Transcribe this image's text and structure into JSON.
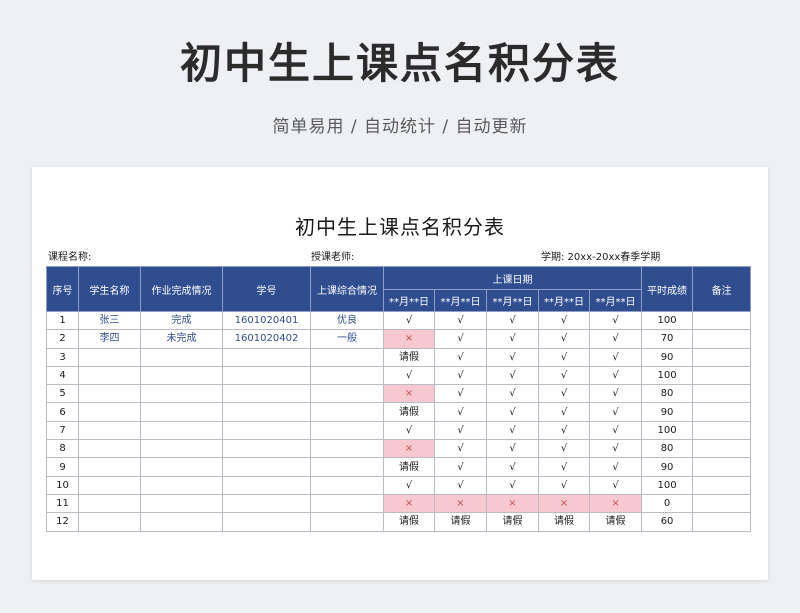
{
  "banner": {
    "title": "初中生上课点名积分表",
    "subtitle": "简单易用 / 自动统计 / 自动更新"
  },
  "sheet": {
    "title": "初中生上课点名积分表",
    "course_label": "课程名称:",
    "teacher_label": "授课老师:",
    "term_label": "学期:  20xx-20xx春季学期"
  },
  "table": {
    "headers": {
      "index": "序号",
      "name": "学生名称",
      "homework": "作业完成情况",
      "student_id": "学号",
      "overall": "上课综合情况",
      "dates_group": "上课日期",
      "dates": [
        "**月**日",
        "**月**日",
        "**月**日",
        "**月**日",
        "**月**日"
      ],
      "score": "平时成绩",
      "remark": "备注"
    },
    "rows": [
      {
        "index": "1",
        "name": "张三",
        "homework": "完成",
        "student_id": "1601020401",
        "overall": "优良",
        "d": [
          "√",
          "√",
          "√",
          "√",
          "√"
        ],
        "score": "100",
        "remark": ""
      },
      {
        "index": "2",
        "name": "李四",
        "homework": "未完成",
        "student_id": "1601020402",
        "overall": "一般",
        "d": [
          "×",
          "√",
          "√",
          "√",
          "√"
        ],
        "score": "70",
        "remark": ""
      },
      {
        "index": "3",
        "name": "",
        "homework": "",
        "student_id": "",
        "overall": "",
        "d": [
          "请假",
          "√",
          "√",
          "√",
          "√"
        ],
        "score": "90",
        "remark": ""
      },
      {
        "index": "4",
        "name": "",
        "homework": "",
        "student_id": "",
        "overall": "",
        "d": [
          "√",
          "√",
          "√",
          "√",
          "√"
        ],
        "score": "100",
        "remark": ""
      },
      {
        "index": "5",
        "name": "",
        "homework": "",
        "student_id": "",
        "overall": "",
        "d": [
          "×",
          "√",
          "√",
          "√",
          "√"
        ],
        "score": "80",
        "remark": ""
      },
      {
        "index": "6",
        "name": "",
        "homework": "",
        "student_id": "",
        "overall": "",
        "d": [
          "请假",
          "√",
          "√",
          "√",
          "√"
        ],
        "score": "90",
        "remark": ""
      },
      {
        "index": "7",
        "name": "",
        "homework": "",
        "student_id": "",
        "overall": "",
        "d": [
          "√",
          "√",
          "√",
          "√",
          "√"
        ],
        "score": "100",
        "remark": ""
      },
      {
        "index": "8",
        "name": "",
        "homework": "",
        "student_id": "",
        "overall": "",
        "d": [
          "×",
          "√",
          "√",
          "√",
          "√"
        ],
        "score": "80",
        "remark": ""
      },
      {
        "index": "9",
        "name": "",
        "homework": "",
        "student_id": "",
        "overall": "",
        "d": [
          "请假",
          "√",
          "√",
          "√",
          "√"
        ],
        "score": "90",
        "remark": ""
      },
      {
        "index": "10",
        "name": "",
        "homework": "",
        "student_id": "",
        "overall": "",
        "d": [
          "√",
          "√",
          "√",
          "√",
          "√"
        ],
        "score": "100",
        "remark": ""
      },
      {
        "index": "11",
        "name": "",
        "homework": "",
        "student_id": "",
        "overall": "",
        "d": [
          "×",
          "×",
          "×",
          "×",
          "×"
        ],
        "score": "0",
        "remark": ""
      },
      {
        "index": "12",
        "name": "",
        "homework": "",
        "student_id": "",
        "overall": "",
        "d": [
          "请假",
          "请假",
          "请假",
          "请假",
          "请假"
        ],
        "score": "60",
        "remark": ""
      }
    ]
  },
  "colors": {
    "header_bg": "#2f4d8f",
    "absent_bg": "#f8c8d0",
    "absent_text": "#c0504d",
    "student_text": "#2f4d8f"
  }
}
